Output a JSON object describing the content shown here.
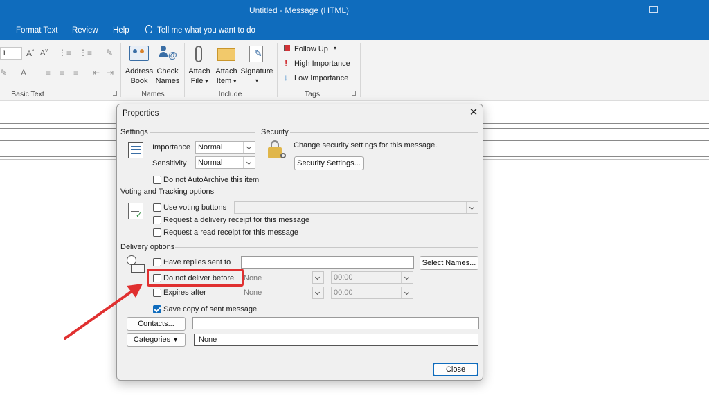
{
  "window": {
    "title": "Untitled  -  Message (HTML)"
  },
  "menu": [
    "Format Text",
    "Review",
    "Help"
  ],
  "tell_me": "Tell me what you want to do",
  "ribbon": {
    "basic_text": {
      "label": "Basic Text",
      "font_size": "1"
    },
    "names": {
      "label": "Names",
      "address_book": [
        "Address",
        "Book"
      ],
      "check_names": [
        "Check",
        "Names"
      ]
    },
    "include": {
      "label": "Include",
      "attach_file": [
        "Attach",
        "File"
      ],
      "attach_item": [
        "Attach",
        "Item"
      ],
      "signature": "Signature"
    },
    "tags": {
      "label": "Tags",
      "follow_up": "Follow Up",
      "high_importance": "High Importance",
      "low_importance": "Low Importance"
    }
  },
  "dialog": {
    "title": "Properties",
    "settings": {
      "title": "Settings",
      "importance_label": "Importance",
      "importance_value": "Normal",
      "sensitivity_label": "Sensitivity",
      "sensitivity_value": "Normal",
      "autoarchive": "Do not AutoArchive this item"
    },
    "security": {
      "title": "Security",
      "text": "Change security settings for this message.",
      "button": "Security Settings..."
    },
    "voting": {
      "title": "Voting and Tracking options",
      "use_voting": "Use voting buttons",
      "delivery_receipt": "Request a delivery receipt for this message",
      "read_receipt": "Request a read receipt for this message"
    },
    "delivery": {
      "title": "Delivery options",
      "replies_to": "Have replies sent to",
      "select_names": "Select Names...",
      "do_not_deliver": "Do not deliver before",
      "deliver_date": "None",
      "deliver_time": "00:00",
      "expires": "Expires after",
      "expires_date": "None",
      "expires_time": "00:00",
      "save_copy": "Save copy of sent message",
      "save_copy_checked": true
    },
    "contacts_button": "Contacts...",
    "categories_button": "Categories",
    "categories_value": "None",
    "close_button": "Close"
  },
  "colors": {
    "accent": "#0f6cbd",
    "highlight": "#e03030"
  }
}
